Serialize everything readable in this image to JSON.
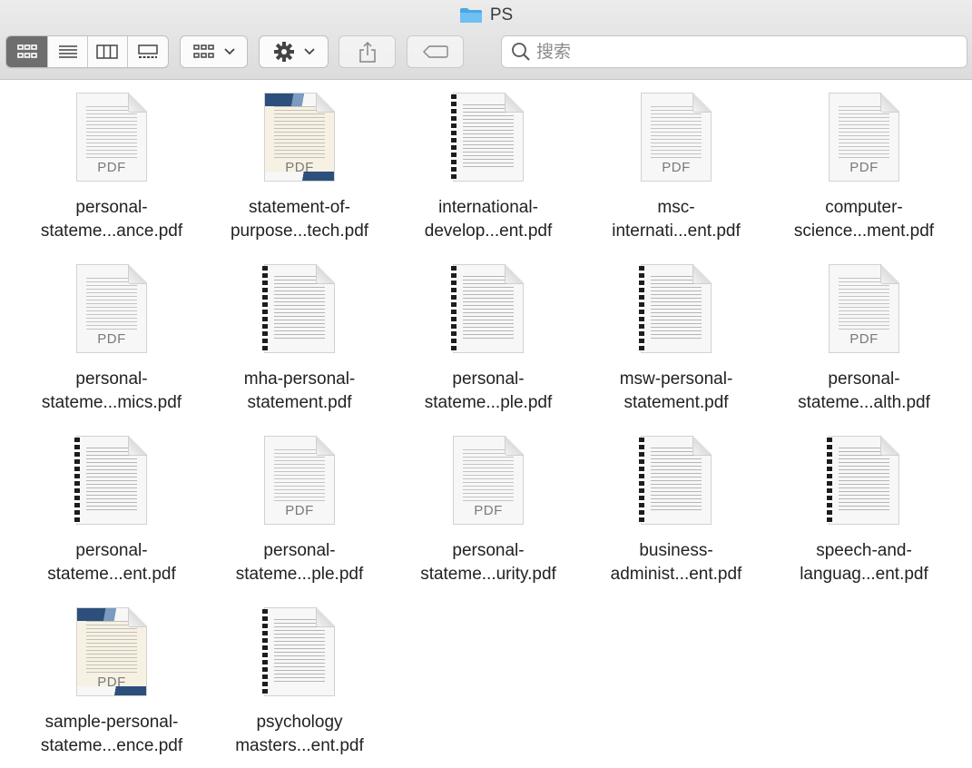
{
  "window": {
    "title": "PS",
    "folder_icon": "folder-icon",
    "accent": "#5ab0e6"
  },
  "toolbar": {
    "view_modes": [
      {
        "name": "icon-view",
        "icon": "grid-icon",
        "active": true
      },
      {
        "name": "list-view",
        "icon": "list-icon",
        "active": false
      },
      {
        "name": "column-view",
        "icon": "columns-icon",
        "active": false
      },
      {
        "name": "gallery-view",
        "icon": "gallery-icon",
        "active": false
      }
    ],
    "group_button_icon": "grid-icon",
    "action_button_icon": "gear-icon",
    "share_button_icon": "share-icon",
    "tag_button_icon": "tag-icon",
    "search_placeholder": "搜索"
  },
  "files": [
    {
      "line1": "personal-",
      "line2": "stateme...ance.pdf",
      "style": "plain"
    },
    {
      "line1": "statement-of-",
      "line2": "purpose...tech.pdf",
      "style": "cover"
    },
    {
      "line1": "international-",
      "line2": "develop...ent.pdf",
      "style": "bound"
    },
    {
      "line1": "msc-",
      "line2": "internati...ent.pdf",
      "style": "plain"
    },
    {
      "line1": "computer-",
      "line2": "science...ment.pdf",
      "style": "plain"
    },
    {
      "line1": "personal-",
      "line2": "stateme...mics.pdf",
      "style": "plain"
    },
    {
      "line1": "mha-personal-",
      "line2": "statement.pdf",
      "style": "bound"
    },
    {
      "line1": "personal-",
      "line2": "stateme...ple.pdf",
      "style": "bound"
    },
    {
      "line1": "msw-personal-",
      "line2": "statement.pdf",
      "style": "bound"
    },
    {
      "line1": "personal-",
      "line2": "stateme...alth.pdf",
      "style": "plain"
    },
    {
      "line1": "personal-",
      "line2": "stateme...ent.pdf",
      "style": "bound"
    },
    {
      "line1": "personal-",
      "line2": "stateme...ple.pdf",
      "style": "plain"
    },
    {
      "line1": "personal-",
      "line2": "stateme...urity.pdf",
      "style": "plain"
    },
    {
      "line1": "business-",
      "line2": "administ...ent.pdf",
      "style": "bound"
    },
    {
      "line1": "speech-and-",
      "line2": "languag...ent.pdf",
      "style": "bound"
    },
    {
      "line1": "sample-personal-",
      "line2": "stateme...ence.pdf",
      "style": "cover"
    },
    {
      "line1": "psychology",
      "line2": "masters...ent.pdf",
      "style": "bound"
    }
  ],
  "pdf_badge": "PDF"
}
